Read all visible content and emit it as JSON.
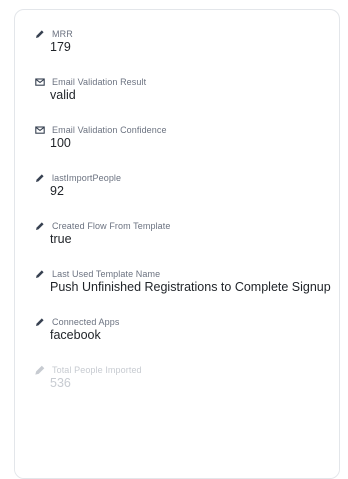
{
  "attributes": [
    {
      "label": "MRR",
      "value": "179",
      "icon": "pencil-icon"
    },
    {
      "label": "Email Validation Result",
      "value": "valid",
      "icon": "envelope-icon"
    },
    {
      "label": "Email Validation Confidence",
      "value": "100",
      "icon": "envelope-icon"
    },
    {
      "label": "lastImportPeople",
      "value": "92",
      "icon": "pencil-icon"
    },
    {
      "label": "Created Flow From Template",
      "value": "true",
      "icon": "pencil-icon"
    },
    {
      "label": "Last Used Template Name",
      "value": "Push Unfinished Registrations to Complete Signup",
      "icon": "pencil-icon"
    },
    {
      "label": "Connected Apps",
      "value": "facebook",
      "icon": "pencil-icon"
    },
    {
      "label": "Total People Imported",
      "value": "536",
      "icon": "pencil-icon"
    }
  ]
}
